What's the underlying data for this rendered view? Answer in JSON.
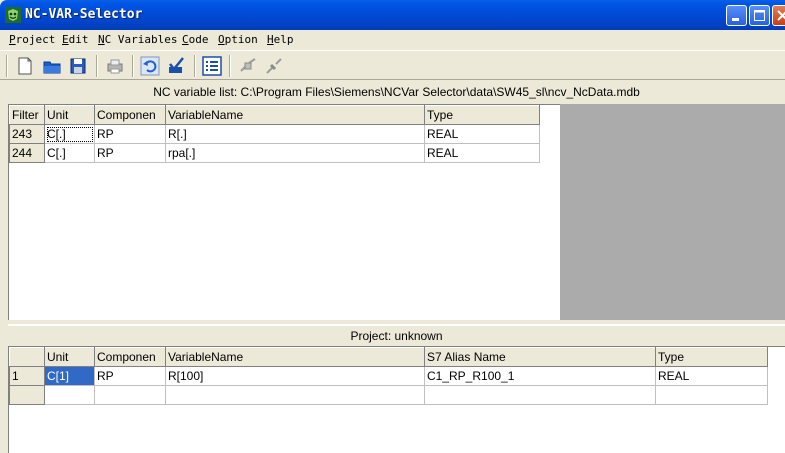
{
  "window": {
    "title": "NC-VAR-Selector",
    "accent": "#0055E5"
  },
  "menu": [
    {
      "label": "Project",
      "ul": "P",
      "rest": "roject"
    },
    {
      "label": "Edit",
      "ul": "E",
      "rest": "dit"
    },
    {
      "label": "NC Variables",
      "ul": "N",
      "rest": "C Variables"
    },
    {
      "label": "Code",
      "ul": "C",
      "rest": "ode"
    },
    {
      "label": "Option",
      "ul": "O",
      "rest": "ption"
    },
    {
      "label": "Help",
      "ul": "H",
      "rest": "elp"
    }
  ],
  "toolbar": [
    "new-file-icon",
    "open-folder-icon",
    "save-icon",
    "print-icon",
    "undo-icon",
    "check-icon",
    "list-icon",
    "connect-icon",
    "disconnect-icon"
  ],
  "nc_list": {
    "header": "NC variable list:  C:\\Program Files\\Siemens\\NCVar Selector\\data\\SW45_sl\\ncv_NcData.mdb",
    "columns": [
      "Filter",
      "Unit",
      "Componen",
      "VariableName",
      "Type"
    ],
    "rows": [
      [
        "243",
        "C[.]",
        "RP",
        "R[.]",
        "REAL"
      ],
      [
        "244",
        "C[.]",
        "RP",
        "rpa[.]",
        "REAL"
      ]
    ]
  },
  "project": {
    "header": "Project:  unknown",
    "columns": [
      "",
      "Unit",
      "Componen",
      "VariableName",
      "S7 Alias Name",
      "Type"
    ],
    "rows": [
      [
        "1",
        "C[1]",
        "RP",
        "R[100]",
        "C1_RP_R100_1",
        "REAL"
      ],
      [
        "",
        "",
        "",
        "",
        "",
        ""
      ]
    ]
  }
}
